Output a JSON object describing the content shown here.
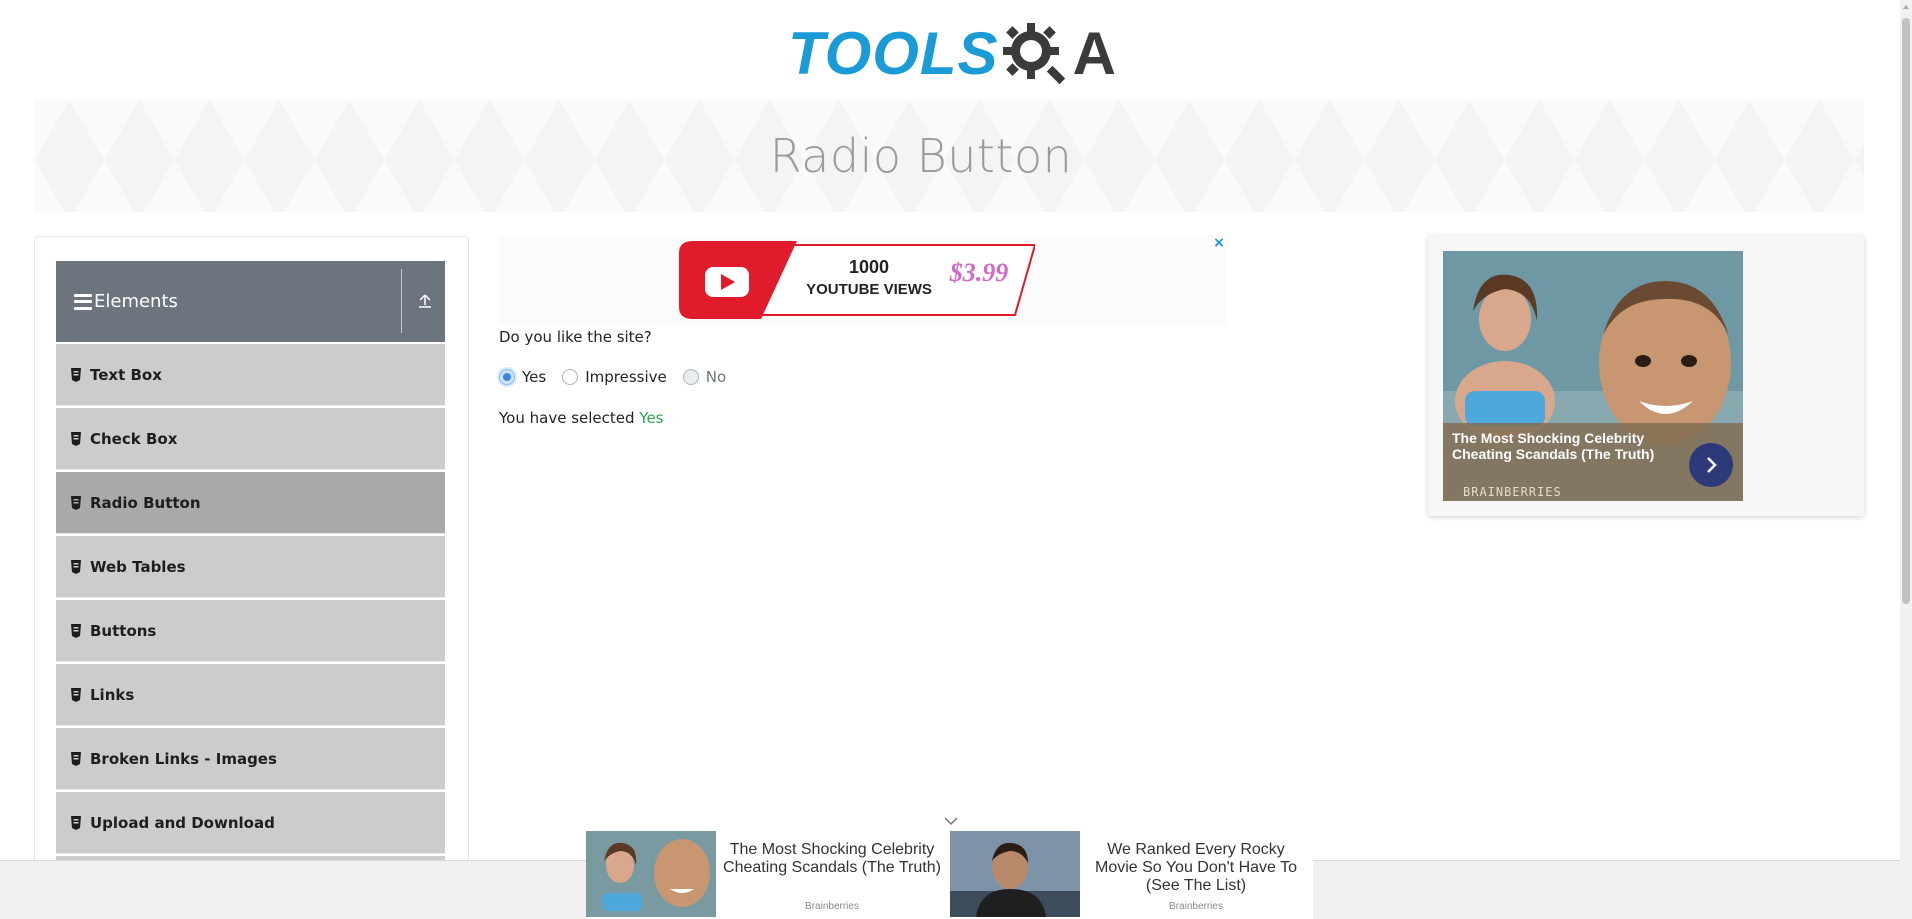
{
  "logo": {
    "tools": "TOOLS",
    "qa": "A"
  },
  "page": {
    "title": "Radio Button"
  },
  "sidebar": {
    "group_title": "Elements",
    "items": [
      {
        "label": "Text Box",
        "active": false
      },
      {
        "label": "Check Box",
        "active": false
      },
      {
        "label": "Radio Button",
        "active": true
      },
      {
        "label": "Web Tables",
        "active": false
      },
      {
        "label": "Buttons",
        "active": false
      },
      {
        "label": "Links",
        "active": false
      },
      {
        "label": "Broken Links - Images",
        "active": false
      },
      {
        "label": "Upload and Download",
        "active": false
      }
    ]
  },
  "ad_top": {
    "line1": "1000",
    "line2": "YOUTUBE VIEWS",
    "price": "$3.99",
    "close": "×"
  },
  "form": {
    "question": "Do you like the site?",
    "options": [
      {
        "label": "Yes",
        "checked": true,
        "disabled": false
      },
      {
        "label": "Impressive",
        "checked": false,
        "disabled": false
      },
      {
        "label": "No",
        "checked": false,
        "disabled": true
      }
    ],
    "result_prefix": "You have selected ",
    "result_value": "Yes"
  },
  "ad_right": {
    "headline": "The Most Shocking Celebrity Cheating Scandals (The Truth)",
    "brand": "BRAINBERRIES"
  },
  "ad_bottom": [
    {
      "text": "The Most Shocking Celebrity Cheating Scandals (The Truth)",
      "source": "Brainberries"
    },
    {
      "text": "We Ranked Every Rocky Movie So You Don't Have To (See The List)",
      "source": "Brainberries"
    }
  ],
  "colors": {
    "accent": "#1a9bd7",
    "success": "#28a745",
    "sidebar_header": "#6c757d",
    "sidebar_item": "#cccccc",
    "sidebar_active": "#a9a9a9"
  }
}
